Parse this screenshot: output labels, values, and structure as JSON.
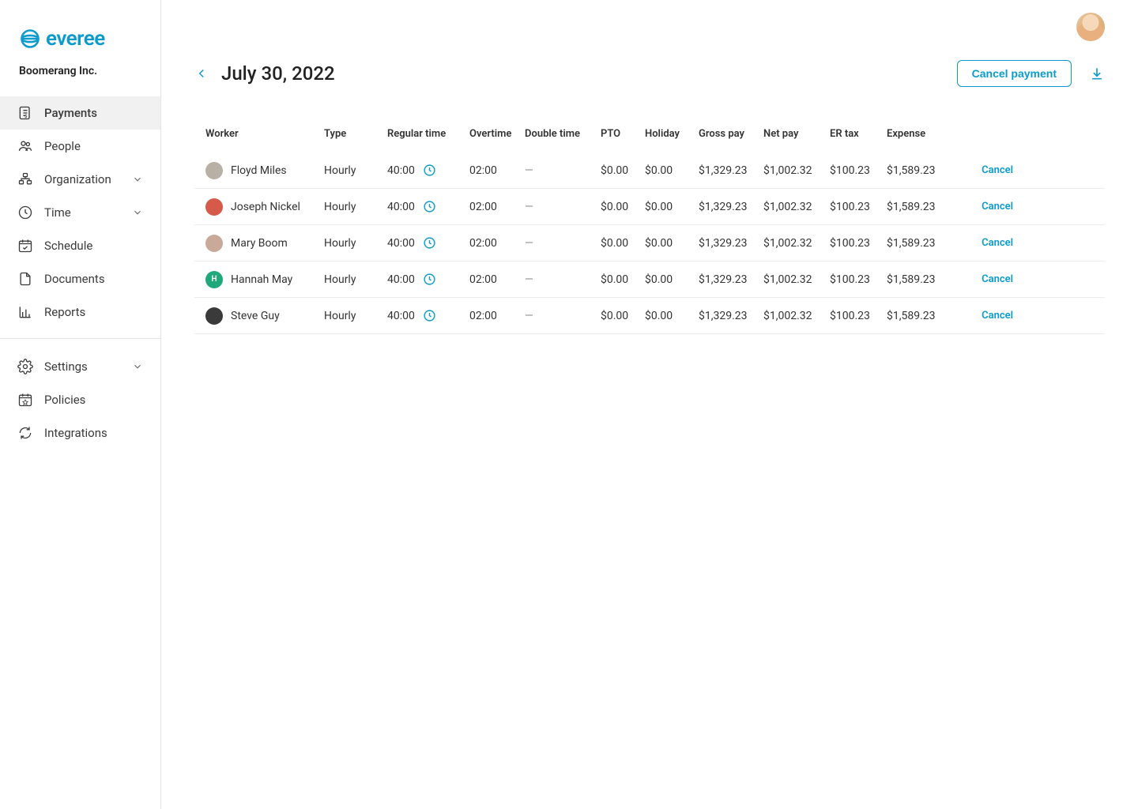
{
  "brand": "everee",
  "org_name": "Boomerang Inc.",
  "nav": {
    "main": [
      {
        "label": "Payments",
        "icon": "payments"
      },
      {
        "label": "People",
        "icon": "people"
      },
      {
        "label": "Organization",
        "icon": "org",
        "expandable": true
      },
      {
        "label": "Time",
        "icon": "time",
        "expandable": true
      },
      {
        "label": "Schedule",
        "icon": "schedule"
      },
      {
        "label": "Documents",
        "icon": "documents"
      },
      {
        "label": "Reports",
        "icon": "reports"
      }
    ],
    "secondary": [
      {
        "label": "Settings",
        "icon": "settings",
        "expandable": true
      },
      {
        "label": "Policies",
        "icon": "policies"
      },
      {
        "label": "Integrations",
        "icon": "integrations"
      }
    ]
  },
  "page": {
    "title": "July 30, 2022",
    "cancel_payment_label": "Cancel payment"
  },
  "table": {
    "headers": {
      "worker": "Worker",
      "type": "Type",
      "regular_time": "Regular time",
      "overtime": "Overtime",
      "double_time": "Double time",
      "pto": "PTO",
      "holiday": "Holiday",
      "gross_pay": "Gross pay",
      "net_pay": "Net pay",
      "er_tax": "ER tax",
      "expense": "Expense"
    },
    "rows": [
      {
        "name": "Floyd Miles",
        "type": "Hourly",
        "regular": "40:00",
        "overtime": "02:00",
        "double": "—",
        "pto": "$0.00",
        "holiday": "$0.00",
        "gross": "$1,329.23",
        "net": "$1,002.32",
        "er": "$100.23",
        "expense": "$1,589.23",
        "cancel": "Cancel",
        "avatar_bg": "#b9b0a5",
        "avatar_txt": ""
      },
      {
        "name": "Joseph Nickel",
        "type": "Hourly",
        "regular": "40:00",
        "overtime": "02:00",
        "double": "—",
        "pto": "$0.00",
        "holiday": "$0.00",
        "gross": "$1,329.23",
        "net": "$1,002.32",
        "er": "$100.23",
        "expense": "$1,589.23",
        "cancel": "Cancel",
        "avatar_bg": "#d65a4a",
        "avatar_txt": ""
      },
      {
        "name": "Mary Boom",
        "type": "Hourly",
        "regular": "40:00",
        "overtime": "02:00",
        "double": "—",
        "pto": "$0.00",
        "holiday": "$0.00",
        "gross": "$1,329.23",
        "net": "$1,002.32",
        "er": "$100.23",
        "expense": "$1,589.23",
        "cancel": "Cancel",
        "avatar_bg": "#c9a99a",
        "avatar_txt": ""
      },
      {
        "name": "Hannah May",
        "type": "Hourly",
        "regular": "40:00",
        "overtime": "02:00",
        "double": "—",
        "pto": "$0.00",
        "holiday": "$0.00",
        "gross": "$1,329.23",
        "net": "$1,002.32",
        "er": "$100.23",
        "expense": "$1,589.23",
        "cancel": "Cancel",
        "avatar_bg": "#1fa87a",
        "avatar_txt": "H"
      },
      {
        "name": "Steve Guy",
        "type": "Hourly",
        "regular": "40:00",
        "overtime": "02:00",
        "double": "—",
        "pto": "$0.00",
        "holiday": "$0.00",
        "gross": "$1,329.23",
        "net": "$1,002.32",
        "er": "$100.23",
        "expense": "$1,589.23",
        "cancel": "Cancel",
        "avatar_bg": "#3a3a3a",
        "avatar_txt": ""
      }
    ]
  }
}
